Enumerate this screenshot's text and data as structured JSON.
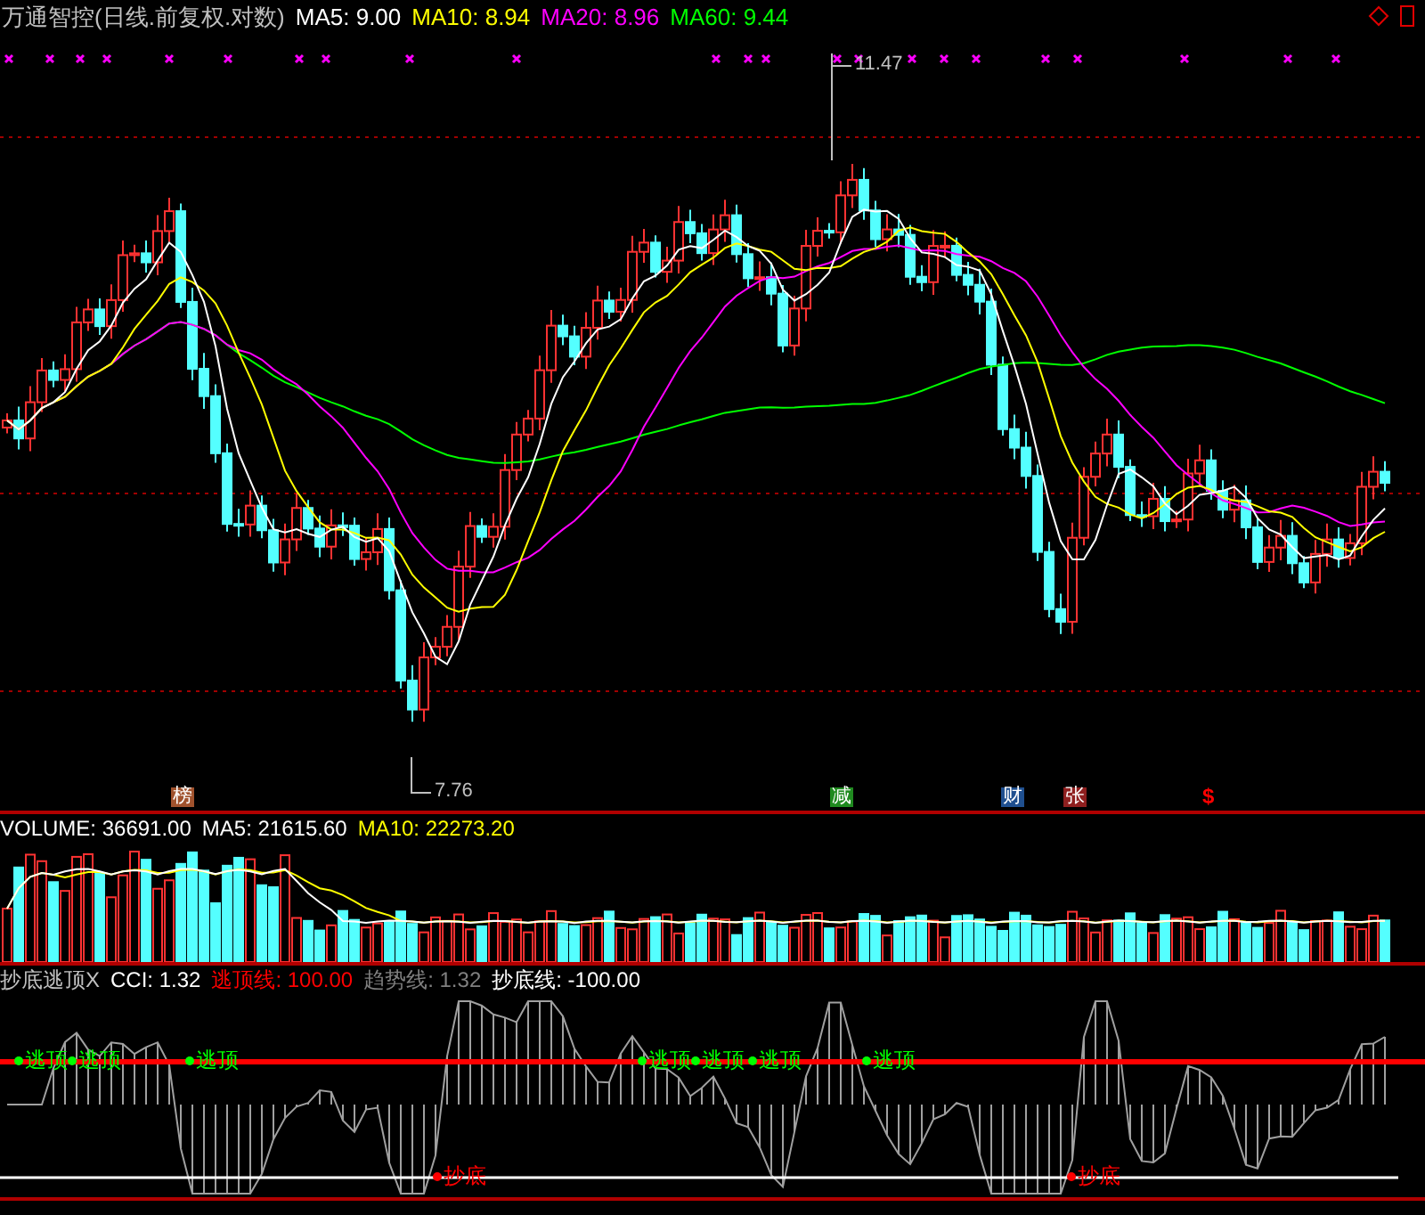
{
  "title": "万通智控(日线.前复权.对数)",
  "ma_values": [
    {
      "label": "MA5: 9.00",
      "color": "#ffffff"
    },
    {
      "label": "MA10: 8.94",
      "color": "#ffff00"
    },
    {
      "label": "MA20: 8.96",
      "color": "#ff00ff"
    },
    {
      "label": "MA60: 9.44",
      "color": "#00ff00"
    }
  ],
  "price_labels": {
    "high": "11.47",
    "low": "7.76"
  },
  "events": [
    {
      "text": "榜",
      "color": "#a0522d"
    },
    {
      "text": "减",
      "color": "#1f8a1f"
    },
    {
      "text": "财",
      "color": "#1f4f8f"
    },
    {
      "text": "张",
      "color": "#8f1f1f"
    }
  ],
  "dividend_mark": "$",
  "volume_header": [
    {
      "label": "VOLUME: 36691.00",
      "color": "#ffffff"
    },
    {
      "label": "MA5: 21615.60",
      "color": "#ffffff"
    },
    {
      "label": "MA10: 22273.20",
      "color": "#ffff00"
    }
  ],
  "indicator_header": [
    {
      "label": "抄底逃顶X",
      "color": "#c0c0c0"
    },
    {
      "label": "CCI: 1.32",
      "color": "#ffffff"
    },
    {
      "label": "逃顶线: 100.00",
      "color": "#ff0000"
    },
    {
      "label": "趋势线: 1.32",
      "color": "#808080"
    },
    {
      "label": "抄底线: -100.00",
      "color": "#ffffff"
    }
  ],
  "signals": {
    "escape": [
      "逃顶",
      "逃顶",
      "逃顶",
      "逃顶",
      "逃顶",
      "逃顶",
      "逃顶"
    ],
    "bottom": [
      "抄底",
      "抄底"
    ]
  }
}
